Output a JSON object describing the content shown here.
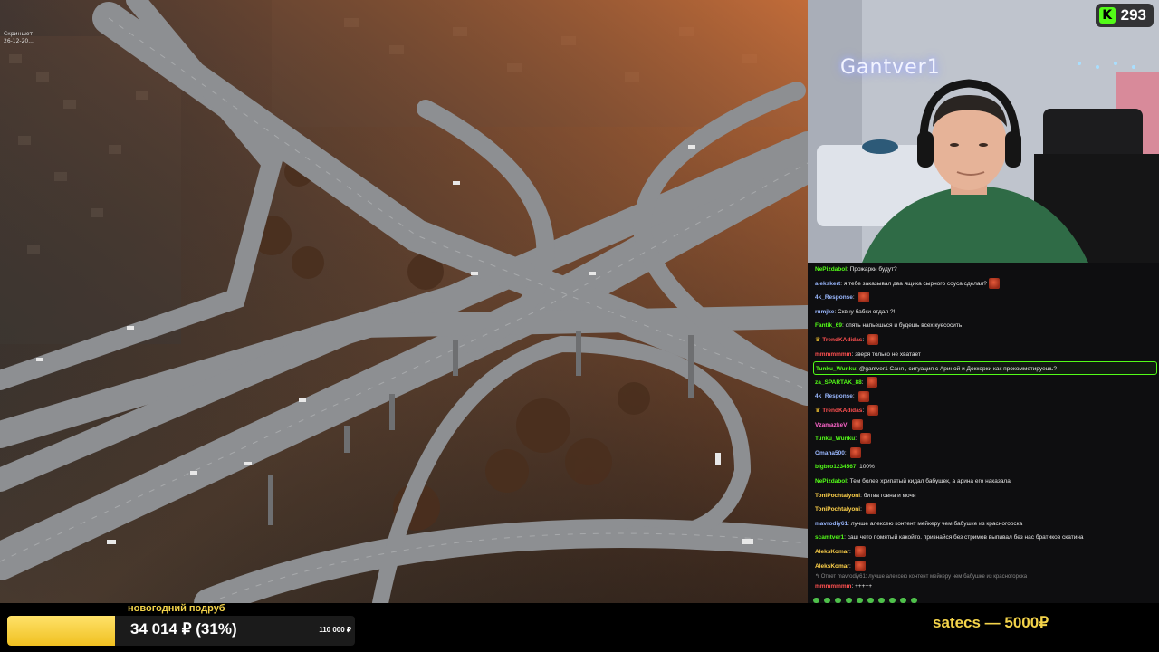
{
  "screen_label": {
    "line1": "Скриншот",
    "line2": "26-12-20..."
  },
  "webcam": {
    "neon_sign": "Gantver1",
    "viewer_count": "293",
    "platform_icon": "kick-icon"
  },
  "chat": {
    "messages": [
      {
        "user": "NePizdabol",
        "color": "#53fc18",
        "text": "Прожарки будут?",
        "emote": false
      },
      {
        "user": "alekskert",
        "color": "#9ab8ff",
        "text": "я тебе заказывал два ящика сырного соуса сделал?",
        "emote": true
      },
      {
        "user": "4k_Response",
        "color": "#9ab8ff",
        "text": "",
        "emote": true
      },
      {
        "user": "rumjke",
        "color": "#9ab8ff",
        "text": "Сквну бабки отдал ?!!",
        "emote": false
      },
      {
        "user": "Fantik_69",
        "color": "#53fc18",
        "text": "опять напьешься и будешь всех куесосить",
        "emote": false
      },
      {
        "user": "TrendKAdidas",
        "color": "#ff5050",
        "text": "",
        "emote": true,
        "crown": true
      },
      {
        "user": "mmmmmmm",
        "color": "#ff5050",
        "text": "зверя только не хватает",
        "emote": false
      },
      {
        "user": "Tunku_Wunku",
        "color": "#53fc18",
        "text": "@gantver1 Саня , ситуация с Ариной и Доккорки как прокомметируешь?",
        "emote": false,
        "highlight": true
      },
      {
        "user": "za_SPARTAK_88",
        "color": "#53fc18",
        "text": "",
        "emote": true
      },
      {
        "user": "4k_Response",
        "color": "#9ab8ff",
        "text": "",
        "emote": true
      },
      {
        "user": "TrendKAdidas",
        "color": "#ff5050",
        "text": "",
        "emote": true,
        "crown": true
      },
      {
        "user": "VzamazkeV",
        "color": "#ff66cc",
        "text": "",
        "emote": true
      },
      {
        "user": "Tunku_Wunku",
        "color": "#53fc18",
        "text": "",
        "emote": true
      },
      {
        "user": "Omaha500",
        "color": "#9ab8ff",
        "text": "",
        "emote": true
      },
      {
        "user": "bigbro1234567",
        "color": "#53fc18",
        "text": "100%",
        "emote": false
      },
      {
        "user": "NePizdabol",
        "color": "#53fc18",
        "text": "Тем более хрипатый кидал бабушек, а арина его наказала",
        "emote": false
      },
      {
        "user": "ToniPochtalyoni",
        "color": "#ffd24a",
        "text": "битва говна и мочи",
        "emote": false
      },
      {
        "user": "ToniPochtalyoni",
        "color": "#ffd24a",
        "text": "",
        "emote": true
      },
      {
        "user": "mavrodiy61",
        "color": "#9ab8ff",
        "text": "лучше алексею контент мейкеру чем бабушке из красногорска",
        "emote": false
      },
      {
        "user": "scamtver1",
        "color": "#53fc18",
        "text": "саш чето помятый какойто. признайся без стримов выпивал без нас братиков скатина",
        "emote": false
      },
      {
        "user": "AleksKomar",
        "color": "#ffd24a",
        "text": "",
        "emote": true
      },
      {
        "user": "AleksKomar",
        "color": "#ffd24a",
        "text": "",
        "emote": true
      }
    ],
    "reply_preview": "↰ Ответ mavrodiy61: лучше алексею контент мейкеру чем бабушке из красногорска",
    "last_message": {
      "user": "mmmmmmm",
      "color": "#ff5050",
      "text": "+++++"
    }
  },
  "goal": {
    "title": "новогодний подруб",
    "progress_text": "34 014 ₽ (31%)",
    "target_text": "110 000 ₽",
    "fraction": 0.31
  },
  "donation_ticker": "satecs — 5000₽",
  "colors": {
    "accent_green": "#53fc18",
    "goal_yellow": "#f3d34a"
  }
}
